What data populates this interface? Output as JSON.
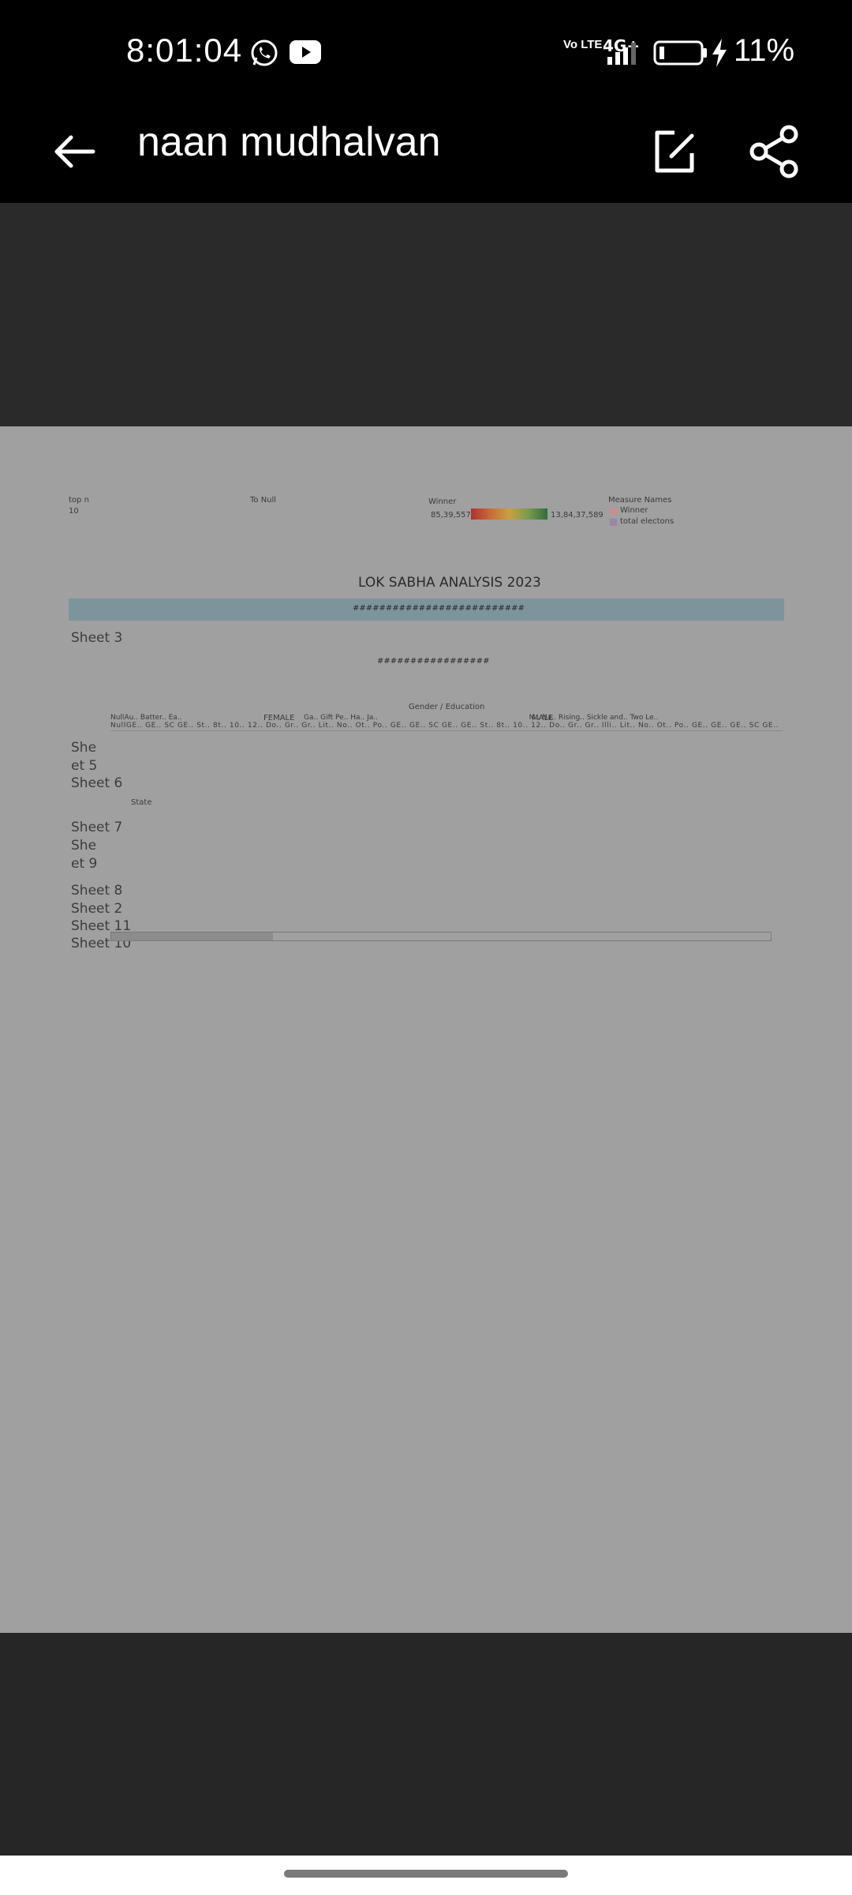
{
  "status_bar": {
    "time": "8:01:04",
    "network": "4G+",
    "volte": "Vo LTE",
    "battery": "11%",
    "icons": [
      "whatsapp-icon",
      "youtube-icon",
      "volte-icon",
      "signal-icon",
      "battery-icon",
      "charging-icon"
    ]
  },
  "app_bar": {
    "title": "naan mudhalvan",
    "back_icon": "back-arrow-icon",
    "edit_icon": "edit-icon",
    "share_icon": "share-icon"
  },
  "dashboard": {
    "top_n_label": "top n",
    "top_n_value": "10",
    "to_null_label": "To Null",
    "winner_label": "Winner",
    "winner_min": "85,39,557",
    "winner_max": "13,84,37,589",
    "measure_names_label": "Measure Names",
    "legend_items": [
      {
        "label": "Winner",
        "color": "#c98f91"
      },
      {
        "label": "total electons",
        "color": "#9b86a8"
      }
    ],
    "title": "LOK SABHA ANALYSIS 2023",
    "banner_text": "##########################",
    "sheet3": "Sheet 3",
    "hash_text": "#################",
    "gender_education_label": "Gender / Education",
    "female_label": "FEMALE",
    "male_label": "MALE",
    "party_row": "NullAu.. Batter.. Ea..                                                      Ga.. Gift Pe.. Ha.. Ja..                                                                   M.. Na.. Rising.. Sickle and.. Two Le..",
    "category_row": "NullGE.. GE.. SC GE.. St.. 8t.. 10.. 12.. Do.. Gr.. Gr.. Lit.. No.. Ot.. Po.. GE.. GE.. SC GE.. GE.. St.. 8t.. 10.. 12.. Do.. Gr.. Gr.. Illi.. Lit.. No.. Ot.. Po.. GE.. GE.. GE.. SC GE.. SC ST GE.. SC",
    "sheet5_line1": "She",
    "sheet5_line2": "et 5",
    "sheet6": "Sheet 6",
    "state_label": "State",
    "sheet7": "Sheet 7",
    "sheet9_line1": "She",
    "sheet9_line2": "et 9",
    "sheet8": "Sheet 8",
    "sheet2": "Sheet 2",
    "sheet11": "Sheet 11",
    "sheet10": "Sheet 10"
  },
  "colors": {
    "doc_bg": "#a0a0a0",
    "banner": "#7d949c",
    "dark_band": "#2a2a2a"
  }
}
